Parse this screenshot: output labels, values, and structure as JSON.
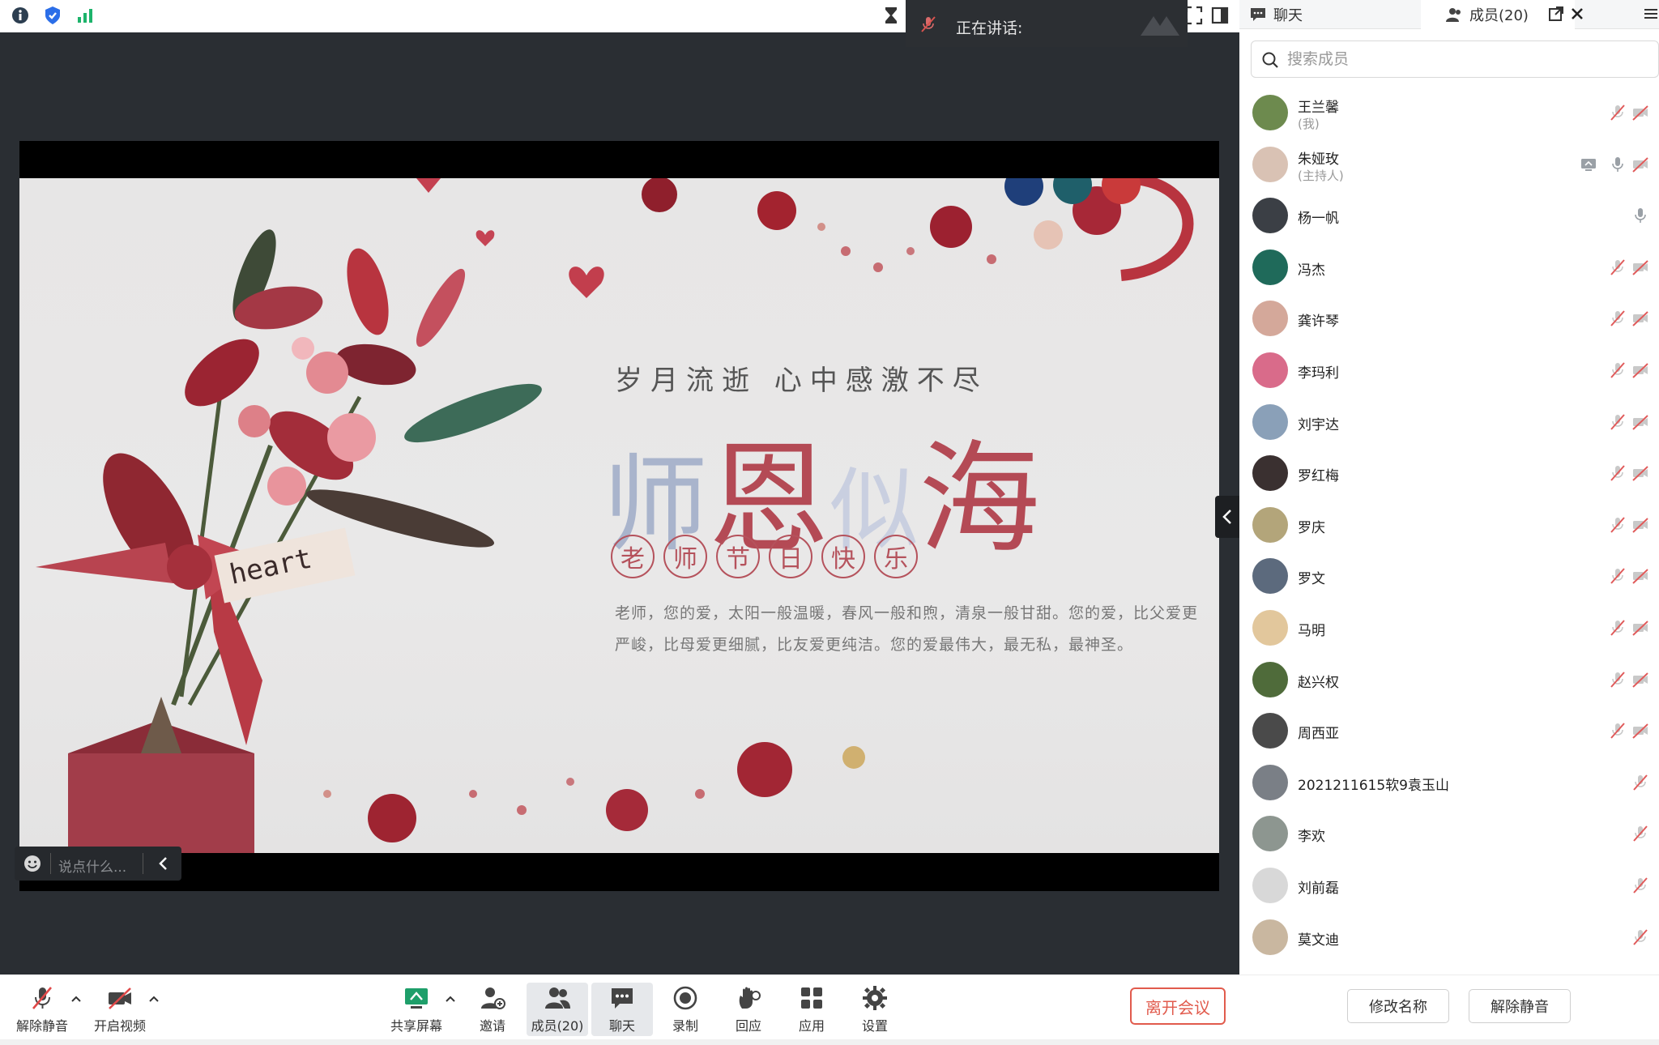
{
  "topbar": {
    "speaking_label": "正在讲话:"
  },
  "slide": {
    "subtitle": "岁月流逝 心中感激不尽",
    "big_chars": [
      "师",
      "恩",
      "似",
      "海"
    ],
    "circle_chars": [
      "老",
      "师",
      "节",
      "日",
      "快",
      "乐"
    ],
    "paragraph": "老师，您的爱，太阳一般温暖，春风一般和煦，清泉一般甘甜。您的爱，比父爱更严峻，比母爱更细腻，比友爱更纯洁。您的爱最伟大，最无私，最神圣。",
    "tag_text": "heart"
  },
  "chat_input": {
    "placeholder": "说点什么..."
  },
  "toolbar": {
    "unmute": "解除静音",
    "start_video": "开启视频",
    "share_screen": "共享屏幕",
    "invite": "邀请",
    "members": "成员(20)",
    "chat": "聊天",
    "record": "录制",
    "react": "回应",
    "apps": "应用",
    "settings": "设置",
    "leave": "离开会议"
  },
  "panel": {
    "tab_chat": "聊天",
    "tab_members": "成员(20)",
    "search_placeholder": "搜索成员",
    "members": [
      {
        "name": "王兰馨",
        "role": "(我)",
        "avatar_color": "#6d8a4e"
      },
      {
        "name": "朱娅玫",
        "role": "(主持人)",
        "avatar_color": "#d9c2b4"
      },
      {
        "name": "杨一帆",
        "role": "",
        "avatar_color": "#3b3f45"
      },
      {
        "name": "冯杰",
        "role": "",
        "avatar_color": "#1f6a5a"
      },
      {
        "name": "龚许琴",
        "role": "",
        "avatar_color": "#d4a89a"
      },
      {
        "name": "李玛利",
        "role": "",
        "avatar_color": "#d96b8a"
      },
      {
        "name": "刘宇达",
        "role": "",
        "avatar_color": "#8aa0b8"
      },
      {
        "name": "罗红梅",
        "role": "",
        "avatar_color": "#3a3030"
      },
      {
        "name": "罗庆",
        "role": "",
        "avatar_color": "#b3a57a"
      },
      {
        "name": "罗文",
        "role": "",
        "avatar_color": "#5c6a7d"
      },
      {
        "name": "马明",
        "role": "",
        "avatar_color": "#e2c79c"
      },
      {
        "name": "赵兴权",
        "role": "",
        "avatar_color": "#4f6b3a"
      },
      {
        "name": "周西亚",
        "role": "",
        "avatar_color": "#4a4a4a"
      },
      {
        "name": "2021211615软9袁玉山",
        "role": "",
        "avatar_color": "#7a7f86"
      },
      {
        "name": "李欢",
        "role": "",
        "avatar_color": "#8d9690"
      },
      {
        "name": "刘前磊",
        "role": "",
        "avatar_color": "#d8d8d8"
      },
      {
        "name": "莫文迪",
        "role": "",
        "avatar_color": "#c9b7a0"
      }
    ],
    "rename_button": "修改名称",
    "unmute_button": "解除静音"
  },
  "colors": {
    "accent_red": "#e15b4d",
    "slide_red": "#b44a55",
    "panel_bg": "#ffffff",
    "stage_bg": "#2a2e33"
  }
}
